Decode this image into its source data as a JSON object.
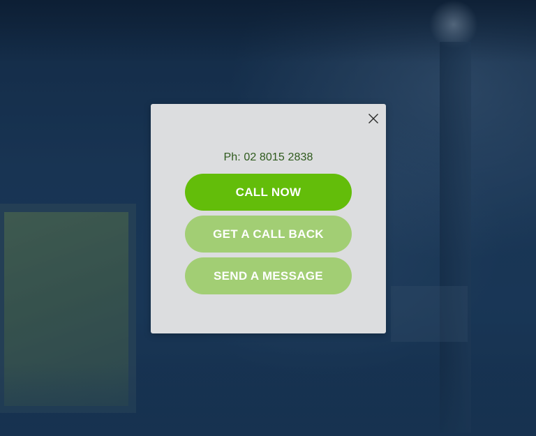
{
  "modal": {
    "phone_text": "Ph: 02 8015 2838",
    "buttons": {
      "call_now": "CALL NOW",
      "call_back": "GET A CALL BACK",
      "send_message": "SEND A MESSAGE"
    },
    "close_icon": "close-icon"
  },
  "colors": {
    "primary_green": "#63bd0a",
    "secondary_green": "#a2ce74",
    "modal_bg": "#dcdddf",
    "phone_text": "#2e5a1c"
  }
}
